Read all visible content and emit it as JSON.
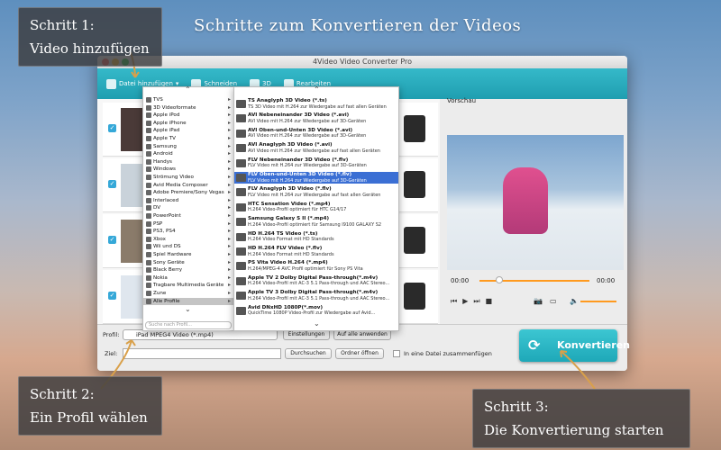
{
  "headline": "Schritte zum Konvertieren der Videos",
  "callouts": {
    "step1": [
      "Schritt 1:",
      "Video hinzufügen"
    ],
    "step2": [
      "Schritt 2:",
      "Ein Profil wählen"
    ],
    "step3": [
      "Schritt 3:",
      "Die Konvertierung starten"
    ]
  },
  "window": {
    "title": "4Video Video Converter Pro",
    "toolbar": [
      "Datei hinzufügen",
      "Schneiden",
      "3D",
      "Rearbeiten"
    ]
  },
  "preview_label": "Vorschau",
  "time_start": "00:00",
  "time_end": "00:00",
  "categories": [
    "TVS",
    "3D Videoformate",
    "Apple iPod",
    "Apple iPhone",
    "Apple iPad",
    "Apple TV",
    "Samsung",
    "Android",
    "Handys",
    "Windows",
    "Strömung Video",
    "Avid Media Composer",
    "Adobe Premiere/Sony Vegas",
    "Interlaced",
    "DV",
    "PowerPoint",
    "PSP",
    "PS3, PS4",
    "Xbox",
    "Wii und DS",
    "Spiel Hardware",
    "Sony Geräte",
    "Black Berry",
    "Nokia",
    "Tragbare Multimedia Geräte",
    "Zune",
    "Alle Profile"
  ],
  "selected_category": "Alle Profile",
  "search_placeholder": "Suche nach Profil...",
  "formats": [
    {
      "name": "TS Anaglyph 3D Video (*.ts)",
      "desc": "TS 3D Video mit H.264 zur Wiedergabe auf fast allen Geräten"
    },
    {
      "name": "AVI Nebeneinander 3D Video (*.avi)",
      "desc": "AVI Video mit H.264 zur Wiedergabe auf 3D-Geräten"
    },
    {
      "name": "AVI Oben-und-Unten 3D Video (*.avi)",
      "desc": "AVI Video mit H.264 zur Wiedergabe auf 3D-Geräten"
    },
    {
      "name": "AVI Anaglyph 3D Video (*.avi)",
      "desc": "AVI Video mit H.264 zur Wiedergabe auf fast allen Geräten"
    },
    {
      "name": "FLV Nebeneinander 3D Video (*.flv)",
      "desc": "FLV Video mit H.264 zur Wiedergabe auf 3D-Geräten"
    },
    {
      "name": "FLV Oben-und-Unten 3D Video (*.flv)",
      "desc": "FLV Video mit H.264 zur Wiedergabe auf 3D-Geräten"
    },
    {
      "name": "FLV Anaglyph 3D Video (*.flv)",
      "desc": "FLV Video mit H.264 zur Wiedergabe auf fast allen Geräten"
    },
    {
      "name": "HTC Sensation Video (*.mp4)",
      "desc": "H.264 Video-Profil optimiert für HTC G14/17"
    },
    {
      "name": "Samsung Galaxy S II (*.mp4)",
      "desc": "H.264 Video-Profil optimiert für Samsung I9100 GALAXY S2"
    },
    {
      "name": "HD H.264 TS Video (*.ts)",
      "desc": "H.264 Video Format mit HD Standards"
    },
    {
      "name": "HD H.264 FLV Video (*.flv)",
      "desc": "H.264 Video Format mit HD Standards"
    },
    {
      "name": "PS Vita Video H.264 (*.mp4)",
      "desc": "H.264/MPEG-4 AVC Profil optimiert für Sony PS Vita"
    },
    {
      "name": "Apple TV 2 Dolby Digital Pass-through(*.m4v)",
      "desc": "H.264 Video-Profil mit AC-3 5.1 Pass-through und AAC Stereo..."
    },
    {
      "name": "Apple TV 3 Dolby Digital Pass-through(*.m4v)",
      "desc": "H.264 Video-Profil mit AC-3 5.1 Pass-through und AAC Stereo..."
    },
    {
      "name": "Avid DNxHD 1080P(*.mov)",
      "desc": "QuickTime 1080P Video-Profil zur Wiedergabe auf Avid..."
    }
  ],
  "selected_format": 5,
  "bottom": {
    "profile_label": "Profil:",
    "profile_value": "iPad MPEG4 Video (*.mp4)",
    "settings": "Einstellungen",
    "apply_all": "Auf alle anwenden",
    "target_label": "Ziel:",
    "browse": "Durchsuchen",
    "open_folder": "Ordner öffnen",
    "merge": "In eine Datei zusammenfügen"
  },
  "convert_label": "Konvertieren",
  "colors": {
    "accent": "#1fa8b9",
    "highlight": "#3b6fd4",
    "callout": "#3c3c3e",
    "arrow": "#d9a04a"
  }
}
